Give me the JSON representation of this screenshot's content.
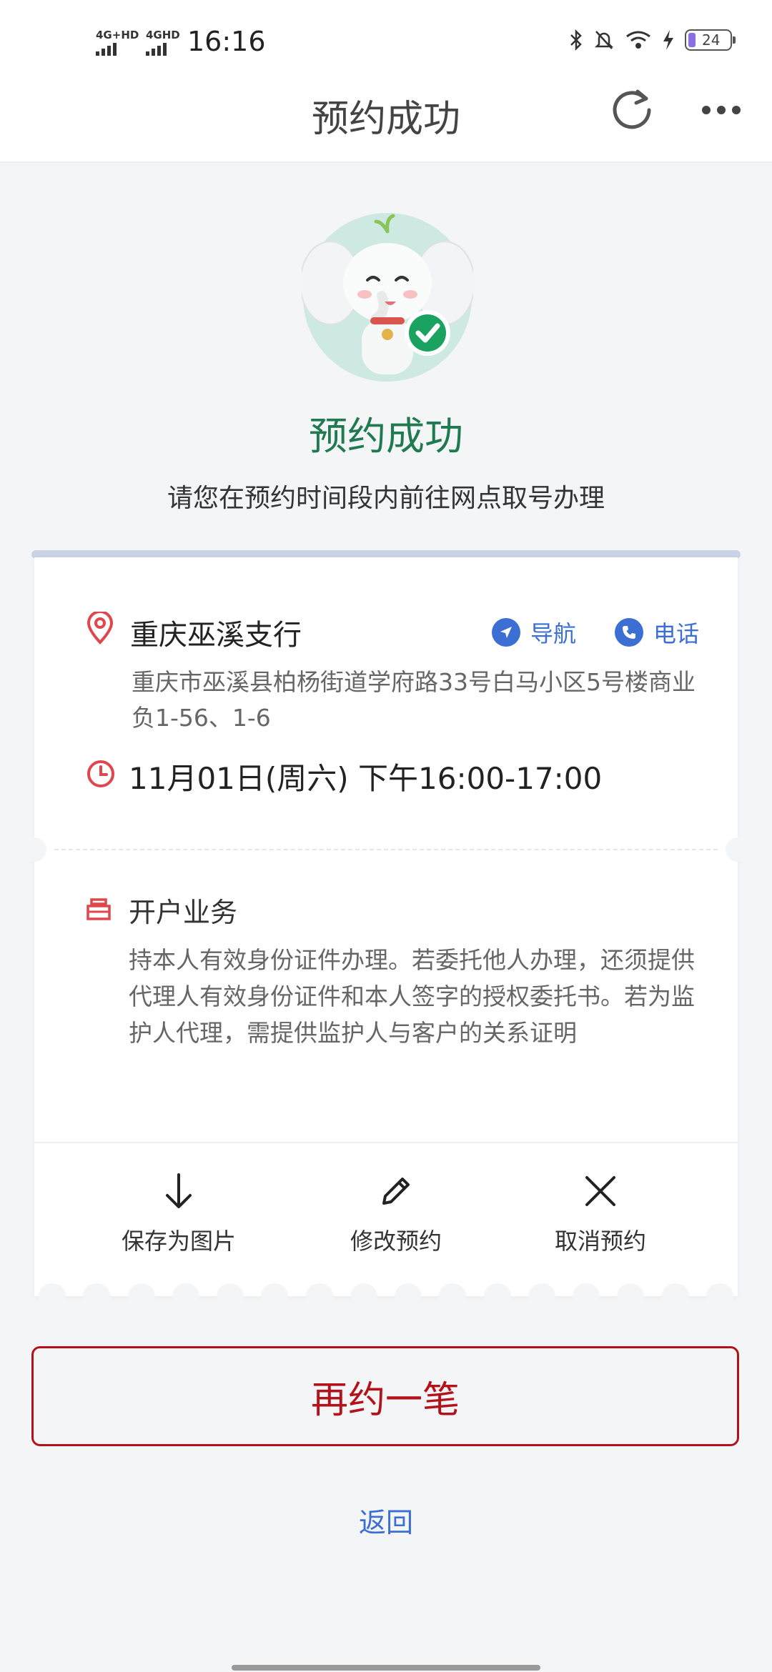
{
  "status_bar": {
    "signal1_label": "4G+HD",
    "signal2_label": "4GHD",
    "time": "16:16",
    "battery_level": "24"
  },
  "header": {
    "title": "预约成功"
  },
  "hero": {
    "title": "预约成功",
    "subtitle": "请您在预约时间段内前往网点取号办理"
  },
  "branch": {
    "name": "重庆巫溪支行",
    "nav_label": "导航",
    "phone_label": "电话",
    "address": "重庆市巫溪县柏杨街道学府路33号白马小区5号楼商业负1-56、1-6",
    "time": "11月01日(周六) 下午16:00-17:00"
  },
  "business": {
    "title": "开户业务",
    "description": "持本人有效身份证件办理。若委托他人办理，还须提供代理人有效身份证件和本人签字的授权委托书。若为监护人代理，需提供监护人与客户的关系证明"
  },
  "actions": {
    "save_label": "保存为图片",
    "modify_label": "修改预约",
    "cancel_label": "取消预约"
  },
  "footer": {
    "rebook_label": "再约一笔",
    "back_label": "返回"
  },
  "colors": {
    "accent_blue": "#3b6fd4",
    "success_green": "#1f7a4f",
    "brand_red": "#b3121b",
    "icon_red": "#e0474c"
  }
}
